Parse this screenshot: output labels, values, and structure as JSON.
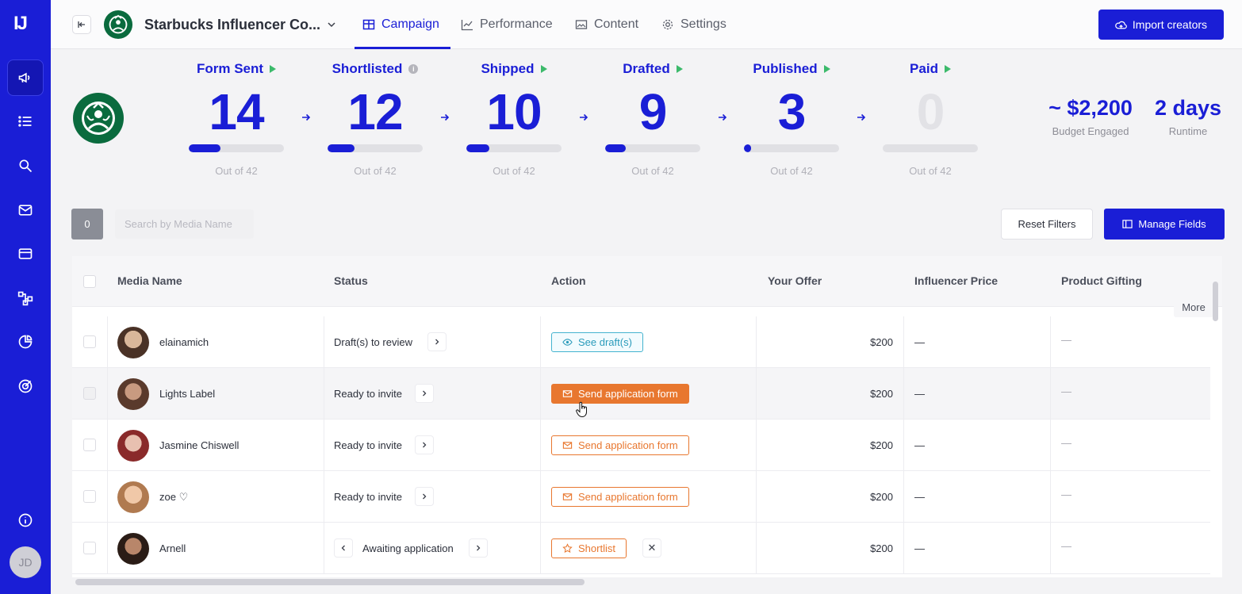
{
  "app": {
    "logo_text": "IJ",
    "campaign_title": "Starbucks Influencer Co...",
    "brand_logo": "starbucks-siren-logo"
  },
  "tabs": [
    {
      "label": "Campaign",
      "icon": "table-icon",
      "active": true
    },
    {
      "label": "Performance",
      "icon": "line-chart-icon",
      "active": false
    },
    {
      "label": "Content",
      "icon": "image-icon",
      "active": false
    },
    {
      "label": "Settings",
      "icon": "gear-icon",
      "active": false
    }
  ],
  "import_button": "Import creators",
  "sidebar": {
    "items": [
      "megaphone-icon",
      "list-icon",
      "search-icon",
      "mail-icon",
      "card-icon",
      "flow-icon",
      "pie-chart-icon",
      "target-icon"
    ],
    "bottom": [
      "info-icon"
    ],
    "user_initials": "JD"
  },
  "stages": [
    {
      "label": "Form Sent",
      "value": "14",
      "progress": 0.333,
      "sub": "Out of 42"
    },
    {
      "label": "Shortlisted",
      "value": "12",
      "progress": 0.286,
      "sub": "Out of 42"
    },
    {
      "label": "Shipped",
      "value": "10",
      "progress": 0.238,
      "sub": "Out of 42"
    },
    {
      "label": "Drafted",
      "value": "9",
      "progress": 0.214,
      "sub": "Out of 42"
    },
    {
      "label": "Published",
      "value": "3",
      "progress": 0.071,
      "sub": "Out of 42"
    },
    {
      "label": "Paid",
      "value": "0",
      "progress": 0,
      "sub": "Out of 42"
    }
  ],
  "summary": {
    "budget_value": "~ $2,200",
    "budget_label": "Budget Engaged",
    "runtime_value": "2 days",
    "runtime_label": "Runtime"
  },
  "filters": {
    "selected_count": "0",
    "search_placeholder": "Search by Media Name",
    "reset_label": "Reset Filters",
    "manage_label": "Manage Fields"
  },
  "table": {
    "columns": [
      "Media Name",
      "Status",
      "Action",
      "Your Offer",
      "Influencer Price",
      "Product Gifting"
    ],
    "more_label": "More",
    "rows": [
      {
        "name": "elainamich",
        "status": "Draft(s) to review",
        "action": "See draft(s)",
        "offer": "$200",
        "price": "—",
        "gifting": "—"
      },
      {
        "name": "Lights Label",
        "status": "Ready to invite",
        "action": "Send application form",
        "offer": "$200",
        "price": "—",
        "gifting": "—"
      },
      {
        "name": "Jasmine Chiswell",
        "status": "Ready to invite",
        "action": "Send application form",
        "offer": "$200",
        "price": "—",
        "gifting": "—"
      },
      {
        "name": "zoe ♡",
        "status": "Ready to invite",
        "action": "Send application form",
        "offer": "$200",
        "price": "—",
        "gifting": "—"
      },
      {
        "name": "Arnell",
        "status": "Awaiting application",
        "action": "Shortlist",
        "offer": "$200",
        "price": "—",
        "gifting": "—"
      }
    ]
  },
  "colors": {
    "primary": "#1a1ed6",
    "accent_orange": "#e8772f",
    "accent_teal": "#2a9bbb",
    "play_green": "#3cba6b"
  }
}
